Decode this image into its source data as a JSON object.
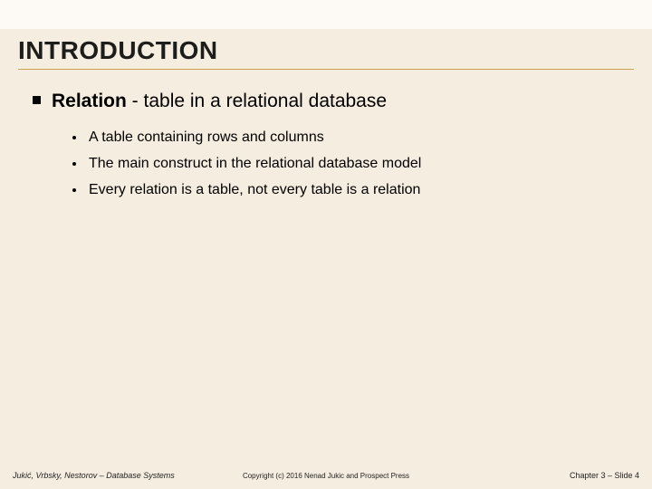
{
  "slide": {
    "heading": "INTRODUCTION",
    "main_point": {
      "term": "Relation",
      "separator": " - ",
      "definition": "table in a relational database"
    },
    "sub_points": [
      "A table containing rows and columns",
      "The main construct in the relational database model",
      "Every relation is a table, not every table is a relation"
    ],
    "footer": {
      "left": "Jukić, Vrbsky, Nestorov – Database Systems",
      "center": "Copyright (c) 2016 Nenad Jukic and Prospect Press",
      "right": "Chapter 3 – Slide 4"
    }
  }
}
